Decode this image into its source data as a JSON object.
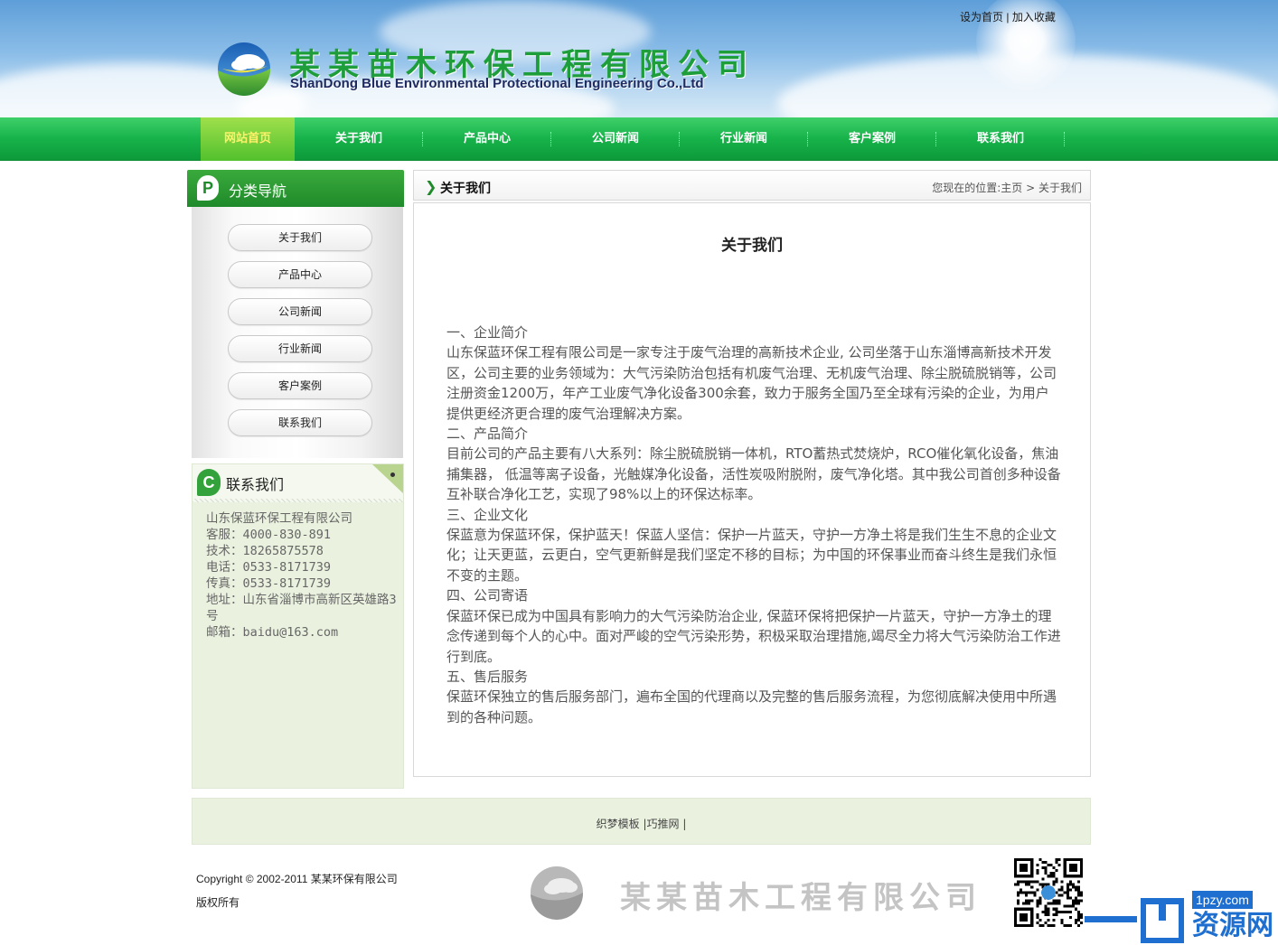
{
  "header": {
    "top_links": [
      "设为首页",
      "加入收藏"
    ],
    "top_links_separator": "|",
    "company_cn": "某某苗木环保工程有限公司",
    "company_en": "ShanDong Blue Environmental Protectional Engineering Co.,Ltd"
  },
  "nav": {
    "items": [
      "网站首页",
      "关于我们",
      "产品中心",
      "公司新闻",
      "行业新闻",
      "客户案例",
      "联系我们"
    ],
    "active_index": 0
  },
  "sidebar": {
    "category_badge": "P",
    "category_title": "分类导航",
    "categories": [
      "关于我们",
      "产品中心",
      "公司新闻",
      "行业新闻",
      "客户案例",
      "联系我们"
    ],
    "contact_badge": "C",
    "contact_title": "联系我们",
    "contact_lines": [
      "山东保蓝环保工程有限公司",
      "客服：4000-830-891",
      "技术：18265875578",
      "电话：0533-8171739",
      "传真：0533-8171739",
      "地址：山东省淄博市高新区英雄路3号",
      "邮箱：baidu@163.com"
    ]
  },
  "main": {
    "section_title": "关于我们",
    "breadcrumb_prefix": "您现在的位置:",
    "breadcrumb_home": "主页",
    "breadcrumb_sep": " > ",
    "breadcrumb_current": "关于我们",
    "article_title": "关于我们",
    "paragraphs": [
      "一、企业简介",
      "山东保蓝环保工程有限公司是一家专注于废气治理的高新技术企业, 公司坐落于山东淄博高新技术开发区，公司主要的业务领域为：大气污染防治包括有机废气治理、无机废气治理、除尘脱硫脱销等，公司注册资金1200万，年产工业废气净化设备300余套，致力于服务全国乃至全球有污染的企业，为用户提供更经济更合理的废气治理解决方案。",
      "二、产品简介",
      "目前公司的产品主要有八大系列：除尘脱硫脱销一体机，RTO蓄热式焚烧炉，RCO催化氧化设备，焦油捕集器， 低温等离子设备，光触媒净化设备，活性炭吸附脱附，废气净化塔。其中我公司首创多种设备互补联合净化工艺，实现了98%以上的环保达标率。",
      "三、企业文化",
      "保蓝意为保蓝环保，保护蓝天！保蓝人坚信：保护一片蓝天，守护一方净土将是我们生生不息的企业文化；让天更蓝，云更白，空气更新鲜是我们坚定不移的目标；为中国的环保事业而奋斗终生是我们永恒不变的主题。",
      "四、公司寄语",
      "保蓝环保已成为中国具有影响力的大气污染防治企业, 保蓝环保将把保护一片蓝天，守护一方净土的理念传递到每个人的心中。面对严峻的空气污染形势，积极采取治理措施,竭尽全力将大气污染防治工作进行到底。",
      "五、售后服务",
      "保蓝环保独立的售后服务部门，遍布全国的代理商以及完整的售后服务流程，为您彻底解决使用中所遇到的各种问题。"
    ]
  },
  "footer": {
    "links": [
      "织梦模板",
      "巧推网"
    ],
    "link_separator": "|",
    "copyright_line1": "Copyright © 2002-2011 某某环保有限公司",
    "copyright_line2": "版权所有",
    "footer_company_name": "某某苗木工程有限公司",
    "watermark_url": "1pzy.com",
    "watermark_text": "资源网"
  },
  "colors": {
    "brand_green": "#1d9e3a",
    "nav_green": "#17b24a",
    "active_nav_text": "#fff26a",
    "contact_bg": "#eaf2df",
    "watermark_blue": "#1e6fcf"
  }
}
